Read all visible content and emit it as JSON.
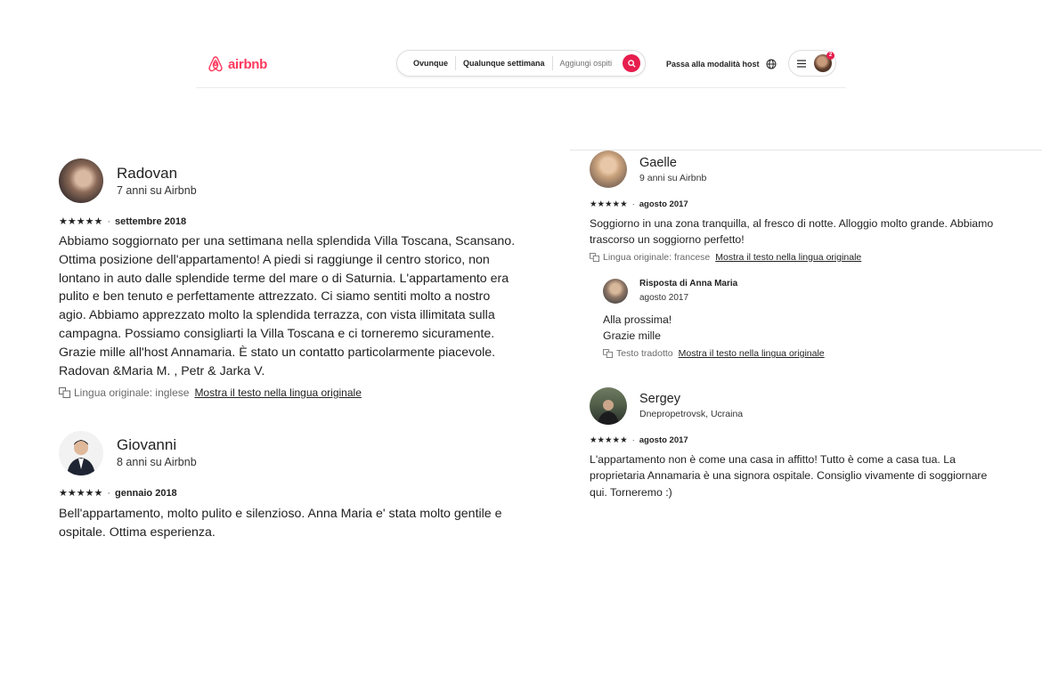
{
  "header": {
    "brand": "airbnb",
    "search": {
      "where": "Ovunque",
      "when": "Qualunque settimana",
      "guests": "Aggiungi ospiti"
    },
    "host_link": "Passa alla modalità host",
    "notification_count": "2",
    "colors": {
      "brand": "#FF385C",
      "search_button": "#E61E4D"
    }
  },
  "reviews_left": [
    {
      "name": "Radovan",
      "meta": "7 anni su Airbnb",
      "stars": "★★★★★",
      "date": "settembre 2018",
      "text_lines": [
        "Abbiamo soggiornato per una settimana nella splendida Villa Toscana, Scansano.",
        "Ottima posizione dell'appartamento! A piedi si raggiunge il centro storico, non",
        "lontano in auto dalle splendide terme del mare o di Saturnia. L'appartamento era",
        "pulito e ben tenuto e perfettamente attrezzato. Ci siamo sentiti molto a nostro",
        "agio. Abbiamo apprezzato molto la splendida terrazza, con vista illimitata sulla",
        "campagna. Possiamo consigliarti la Villa Toscana e ci torneremo sicuramente.",
        "Grazie mille all'host Annamaria. È stato un contatto particolarmente piacevole.",
        "Radovan &Maria M. , Petr & Jarka V."
      ],
      "original_language": "Lingua originale: inglese",
      "show_original": "Mostra il testo nella lingua originale"
    },
    {
      "name": "Giovanni",
      "meta": "8 anni su Airbnb",
      "stars": "★★★★★",
      "date": "gennaio 2018",
      "text_lines": [
        "Bell'appartamento, molto pulito e silenzioso. Anna Maria e' stata molto gentile e",
        "ospitale. Ottima esperienza."
      ]
    }
  ],
  "reviews_right": [
    {
      "name": "Gaelle",
      "meta": "9 anni su Airbnb",
      "stars": "★★★★★",
      "date": "agosto 2017",
      "text_lines": [
        "Soggiorno in una zona tranquilla, al fresco di notte. Alloggio molto grande. Abbiamo",
        "trascorso un soggiorno perfetto!"
      ],
      "original_language": "Lingua originale: francese",
      "show_original": "Mostra il testo nella lingua originale",
      "response": {
        "title": "Risposta di Anna Maria",
        "date": "agosto 2017",
        "text_lines": [
          "Alla prossima!",
          "Grazie mille"
        ],
        "translated": "Testo tradotto",
        "show_original": "Mostra il testo nella lingua originale"
      }
    },
    {
      "name": "Sergey",
      "meta": "Dnepropetrovsk, Ucraina",
      "stars": "★★★★★",
      "date": "agosto 2017",
      "text_lines": [
        "L'appartamento non è come una casa in affitto! Tutto è come a casa tua. La",
        "proprietaria Annamaria è una signora ospitale. Consiglio vivamente di soggiornare",
        "qui. Torneremo :)"
      ]
    }
  ]
}
